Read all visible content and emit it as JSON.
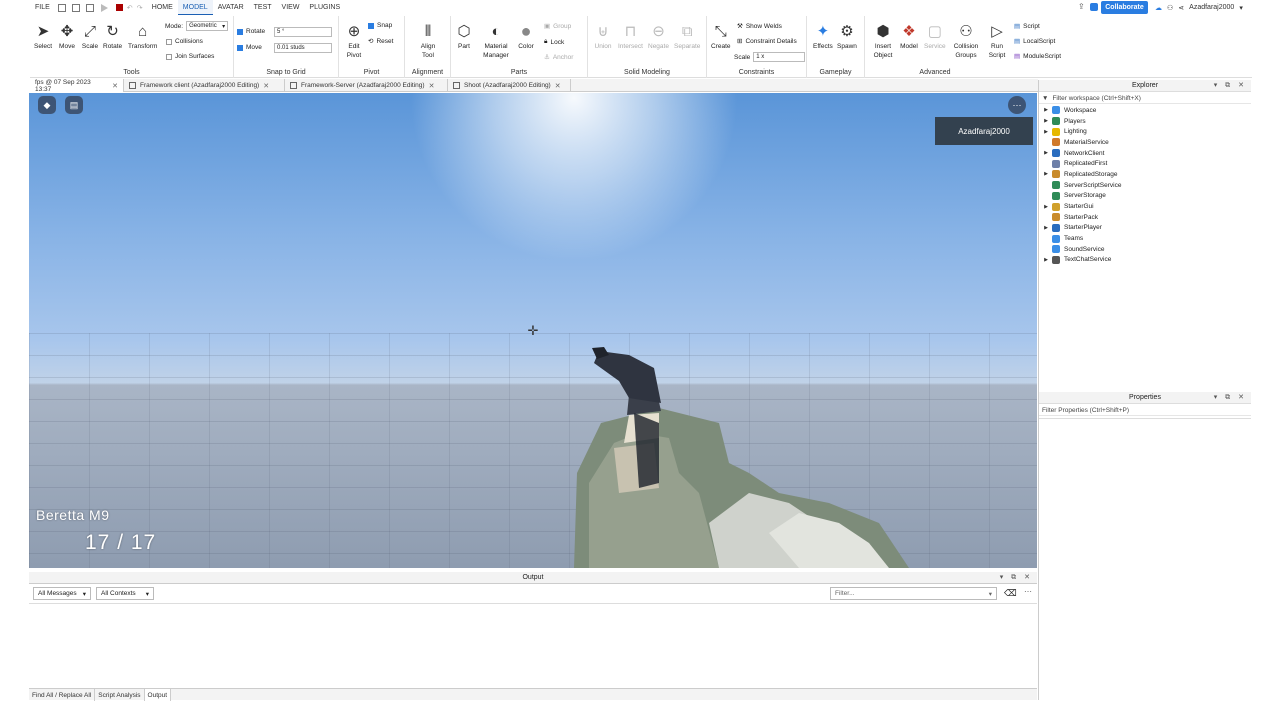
{
  "menubar": {
    "file": "FILE",
    "tabs": [
      "HOME",
      "MODEL",
      "AVATAR",
      "TEST",
      "VIEW",
      "PLUGINS"
    ],
    "active_tab": "MODEL",
    "collaborate": "Collaborate",
    "username": "Azadfaraj2000"
  },
  "ribbon": {
    "tools": {
      "label": "Tools",
      "items": [
        "Select",
        "Move",
        "Scale",
        "Rotate",
        "Transform"
      ],
      "mode_label": "Mode:",
      "mode_value": "Geometric",
      "collisions": "Collisions",
      "join_surfaces": "Join Surfaces"
    },
    "snap": {
      "label": "Snap to Grid",
      "rotate_label": "Rotate",
      "rotate_value": "5 °",
      "move_label": "Move",
      "move_value": "0.01 studs"
    },
    "pivot": {
      "label": "Pivot",
      "edit": "Edit Pivot",
      "snap": "Snap",
      "reset": "Reset"
    },
    "alignment": {
      "label": "Alignment",
      "align": "Align Tool"
    },
    "parts": {
      "label": "Parts",
      "part": "Part",
      "material": "Material Manager",
      "color": "Color",
      "group": "Group",
      "lock": "Lock",
      "anchor": "Anchor"
    },
    "solid": {
      "label": "Solid Modeling",
      "items": [
        "Union",
        "Intersect",
        "Negate",
        "Separate"
      ]
    },
    "constraints": {
      "label": "Constraints",
      "create": "Create",
      "show_welds": "Show Welds",
      "constraint_details": "Constraint Details",
      "scale_label": "Scale",
      "scale_value": "1 x"
    },
    "gameplay": {
      "label": "Gameplay",
      "effects": "Effects",
      "spawn": "Spawn"
    },
    "advanced": {
      "label": "Advanced",
      "items": [
        "Insert Object",
        "Model",
        "Service",
        "Collision Groups",
        "Run Script"
      ],
      "scripts": [
        "Script",
        "LocalScript",
        "ModuleScript"
      ]
    }
  },
  "doc_tabs": [
    {
      "label": "fps @ 07 Sep 2023 13:37"
    },
    {
      "label": "Framework client (Azadfaraj2000 Editing)"
    },
    {
      "label": "Framework-Server (Azadfaraj2000 Editing)"
    },
    {
      "label": "Shoot (Azadfaraj2000 Editing)"
    }
  ],
  "viewport": {
    "player_name": "Azadfaraj2000",
    "weapon_name": "Beretta M9",
    "ammo": "17 / 17"
  },
  "output": {
    "title": "Output",
    "messages_filter": "All Messages",
    "contexts_filter": "All Contexts",
    "filter_placeholder": "Filter..."
  },
  "bottom_tabs": [
    "Find All / Replace All",
    "Script Analysis",
    "Output"
  ],
  "explorer": {
    "title": "Explorer",
    "filter": "Filter workspace (Ctrl+Shift+X)",
    "items": [
      {
        "label": "Workspace",
        "expandable": true,
        "color": "#3a8ee6"
      },
      {
        "label": "Players",
        "expandable": true,
        "color": "#2e8b57"
      },
      {
        "label": "Lighting",
        "expandable": true,
        "color": "#e6b800"
      },
      {
        "label": "MaterialService",
        "expandable": false,
        "color": "#d07a2b"
      },
      {
        "label": "NetworkClient",
        "expandable": true,
        "color": "#2a6dbf"
      },
      {
        "label": "ReplicatedFirst",
        "expandable": false,
        "color": "#6d7fa8"
      },
      {
        "label": "ReplicatedStorage",
        "expandable": true,
        "color": "#c98b2b"
      },
      {
        "label": "ServerScriptService",
        "expandable": false,
        "color": "#2e8b57"
      },
      {
        "label": "ServerStorage",
        "expandable": false,
        "color": "#2e8b57"
      },
      {
        "label": "StarterGui",
        "expandable": true,
        "color": "#d0a02b"
      },
      {
        "label": "StarterPack",
        "expandable": false,
        "color": "#c98b2b"
      },
      {
        "label": "StarterPlayer",
        "expandable": true,
        "color": "#2a6dbf"
      },
      {
        "label": "Teams",
        "expandable": false,
        "color": "#3a8ee6"
      },
      {
        "label": "SoundService",
        "expandable": false,
        "color": "#3a8ee6"
      },
      {
        "label": "TextChatService",
        "expandable": true,
        "color": "#555555"
      }
    ]
  },
  "properties": {
    "title": "Properties",
    "filter": "Filter Properties (Ctrl+Shift+P)"
  }
}
